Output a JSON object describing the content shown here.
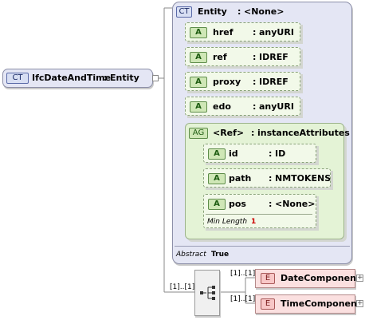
{
  "root": {
    "tag": "CT",
    "name": "IfcDateAndTime",
    "sep": ":",
    "type": "Entity"
  },
  "entity": {
    "tag": "CT",
    "name": "Entity",
    "sep": ":",
    "type": "<None>",
    "abstract_label": "Abstract",
    "abstract_value": "True"
  },
  "attributes": [
    {
      "tag": "A",
      "name": "href",
      "sep": ":",
      "type": "anyURI"
    },
    {
      "tag": "A",
      "name": "ref",
      "sep": ":",
      "type": "IDREF"
    },
    {
      "tag": "A",
      "name": "proxy",
      "sep": ":",
      "type": "IDREF"
    },
    {
      "tag": "A",
      "name": "edo",
      "sep": ":",
      "type": "anyURI"
    }
  ],
  "group": {
    "tag": "AG",
    "name": "<Ref>",
    "sep": ":",
    "type": "instanceAttributes",
    "attributes": [
      {
        "tag": "A",
        "name": "id",
        "sep": ":",
        "type": "ID"
      },
      {
        "tag": "A",
        "name": "path",
        "sep": ":",
        "type": "NMTOKENS"
      },
      {
        "tag": "A",
        "name": "pos",
        "sep": ":",
        "type": "<None>",
        "facet_label": "Min Length",
        "facet_value": "1"
      }
    ]
  },
  "sequence": {
    "multiplicity": "[1]..[1]",
    "elements": [
      {
        "tag": "E",
        "name": "DateComponent",
        "multiplicity": "[1]..[1]"
      },
      {
        "tag": "E",
        "name": "TimeComponent",
        "multiplicity": "[1]..[1]"
      }
    ]
  },
  "colors": {
    "complex_type_fill": "#e4e6f4",
    "attribute_group_fill": "#e4f3d6",
    "element_fill": "#fbe0e0",
    "abstract_value": "#000000",
    "facet_value": "#cc0000"
  }
}
